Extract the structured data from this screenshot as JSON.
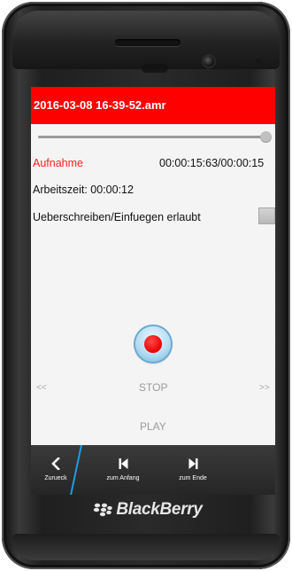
{
  "app": {
    "filename": "2016-03-08 16-39-52.amr",
    "progress_fraction": 0.99
  },
  "status": {
    "mode_label": "Aufnahme",
    "time_readout": "00:00:15:63/00:00:15",
    "work_time": "Arbeitszeit: 00:00:12",
    "overwrite_label": "Ueberschreiben/Einfuegen erlaubt"
  },
  "controls": {
    "prev_label": "<<",
    "next_label": ">>",
    "stop_label": "STOP",
    "play_label": "PLAY"
  },
  "actionbar": {
    "back_label": "Zurueck",
    "to_start_label": "zum Anfang",
    "to_end_label": "zum Ende"
  },
  "device": {
    "brand": "BlackBerry"
  },
  "colors": {
    "accent_red": "#ff0000",
    "actionbar_highlight": "#1aa0e8"
  },
  "icons": {
    "back": "chevron-left-icon",
    "to_start": "skip-to-start-icon",
    "to_end": "skip-to-end-icon",
    "record": "record-icon"
  }
}
